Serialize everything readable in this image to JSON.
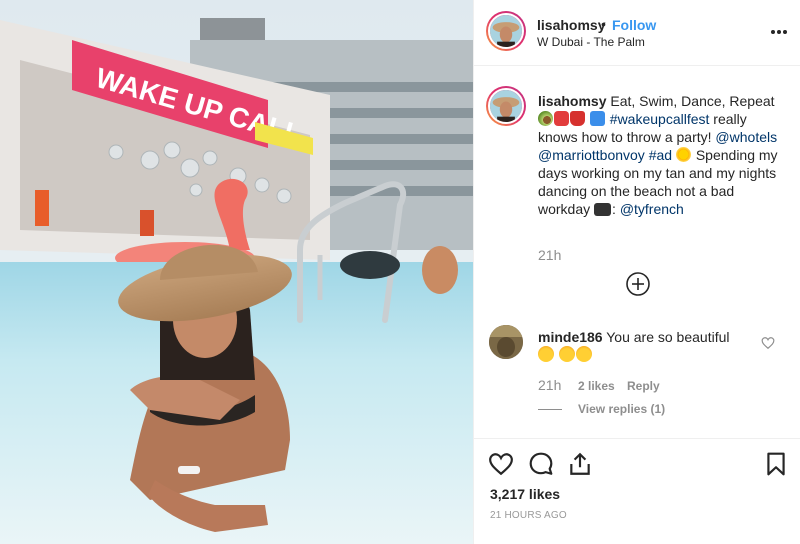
{
  "post": {
    "username": "lisahomsy",
    "separator": "•",
    "follow_label": "Follow",
    "location": "W Dubai - The Palm",
    "photo_sign_text": "WAKE UP CALL",
    "more_icon": "more-options-icon"
  },
  "caption": {
    "username": "lisahomsy",
    "text_1": " Eat, Swim, Dance, Repeat ",
    "hashtag": "#wakeupcallfest",
    "text_2": " really knows how to throw a party! ",
    "mention_1": "@whotels",
    "mention_2": "@marriottbonvoy",
    "ad_tag": "#ad",
    "text_3": " Spending my days working on my tan and my nights dancing on the beach not a bad workday ",
    "credit_suffix": ": ",
    "credit_mention": "@tyfrench",
    "time": "21h",
    "emoji_icons": [
      "avocado-emoji",
      "bikini-emoji",
      "dress-emoji",
      "repeat-emoji",
      "sun-emoji",
      "camera-emoji"
    ]
  },
  "comment": {
    "username": "minde186",
    "text": " You are so beautiful ",
    "time": "21h",
    "likes": "2 likes",
    "reply_label": "Reply",
    "view_replies": "View replies (1)"
  },
  "footer": {
    "likes": "3,217 likes",
    "time_ago": "21 HOURS AGO"
  },
  "colors": {
    "link": "#003569",
    "follow": "#3897f0",
    "muted": "#8e8e8e",
    "sign": "#e8416b"
  }
}
